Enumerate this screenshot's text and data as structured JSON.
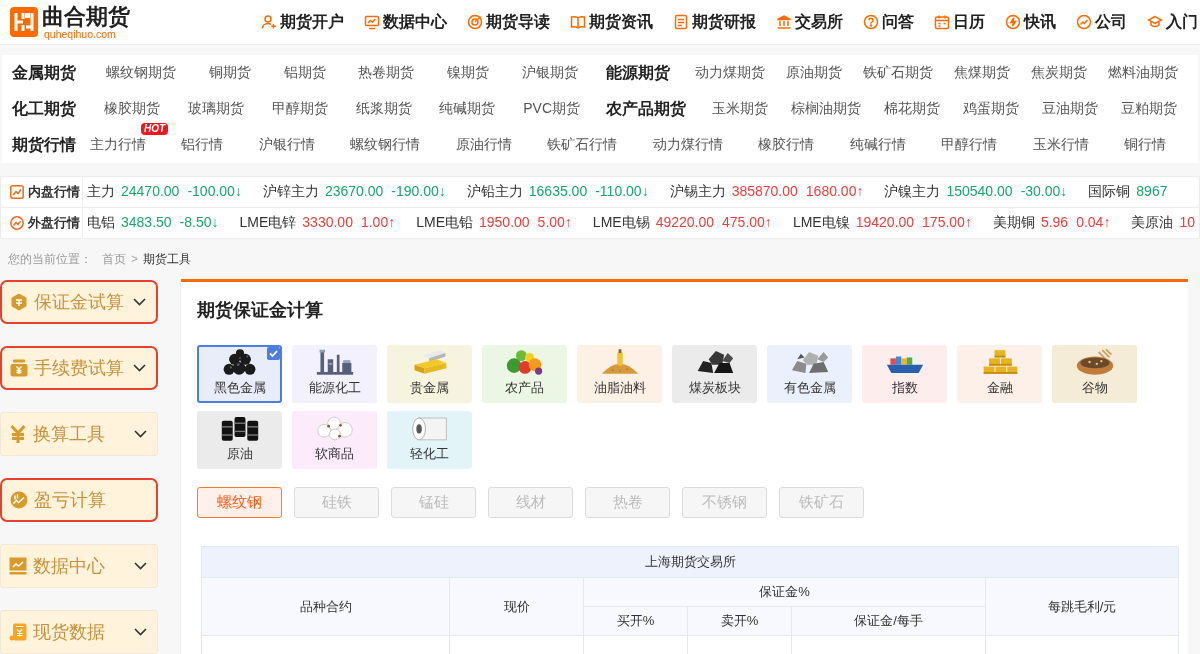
{
  "header": {
    "logo": {
      "name": "曲合期货",
      "domain": "quheqihuo.com"
    },
    "nav": [
      "期货开户",
      "数据中心",
      "期货导读",
      "期货资讯",
      "期货研报",
      "交易所",
      "问答",
      "日历",
      "快讯",
      "公司",
      "入门"
    ]
  },
  "category_nav": {
    "rows": [
      {
        "groups": [
          {
            "title": "金属期货",
            "items": [
              {
                "label": "螺纹钢期货"
              },
              {
                "label": "铜期货"
              },
              {
                "label": "铝期货"
              },
              {
                "label": "热卷期货"
              },
              {
                "label": "镍期货"
              },
              {
                "label": "沪银期货"
              }
            ]
          },
          {
            "title": "能源期货",
            "items": [
              {
                "label": "动力煤期货"
              },
              {
                "label": "原油期货"
              },
              {
                "label": "铁矿石期货"
              },
              {
                "label": "焦煤期货"
              },
              {
                "label": "焦炭期货"
              },
              {
                "label": "燃料油期货"
              }
            ]
          }
        ]
      },
      {
        "groups": [
          {
            "title": "化工期货",
            "items": [
              {
                "label": "橡胶期货"
              },
              {
                "label": "玻璃期货"
              },
              {
                "label": "甲醇期货"
              },
              {
                "label": "纸浆期货"
              },
              {
                "label": "纯碱期货"
              },
              {
                "label": "PVC期货"
              }
            ]
          },
          {
            "title": "农产品期货",
            "items": [
              {
                "label": "玉米期货"
              },
              {
                "label": "棕榈油期货"
              },
              {
                "label": "棉花期货"
              },
              {
                "label": "鸡蛋期货"
              },
              {
                "label": "豆油期货"
              },
              {
                "label": "豆粕期货"
              }
            ]
          }
        ]
      },
      {
        "groups": [
          {
            "title": "期货行情",
            "items": [
              {
                "label": "主力行情",
                "badge": "HOT"
              },
              {
                "label": "铝行情"
              },
              {
                "label": "沪银行情"
              },
              {
                "label": "螺纹钢行情"
              },
              {
                "label": "原油行情"
              },
              {
                "label": "铁矿石行情"
              },
              {
                "label": "动力煤行情"
              },
              {
                "label": "橡胶行情"
              },
              {
                "label": "纯碱行情"
              },
              {
                "label": "甲醇行情"
              },
              {
                "label": "玉米行情"
              },
              {
                "label": "铜行情"
              }
            ]
          }
        ]
      }
    ]
  },
  "tickers": [
    {
      "label": "内盘行情",
      "quotes": [
        {
          "name": "主力",
          "price": "24470.00",
          "change": "-100.00↓",
          "rising": false
        },
        {
          "name": "沪锌主力",
          "price": "23670.00",
          "change": "-190.00↓",
          "rising": false
        },
        {
          "name": "沪铅主力",
          "price": "16635.00",
          "change": "-110.00↓",
          "rising": false
        },
        {
          "name": "沪锡主力",
          "price": "385870.00",
          "change": "1680.00↑",
          "rising": true
        },
        {
          "name": "沪镍主力",
          "price": "150540.00",
          "change": "-30.00↓",
          "rising": false
        },
        {
          "name": "国际铜",
          "price": "8967",
          "rising": false
        }
      ]
    },
    {
      "label": "外盘行情",
      "quotes": [
        {
          "name": "电铝",
          "price": "3483.50",
          "change": "-8.50↓",
          "rising": false
        },
        {
          "name": "LME电锌",
          "price": "3330.00",
          "change": "1.00↑",
          "rising": true
        },
        {
          "name": "LME电铅",
          "price": "1950.00",
          "change": "5.00↑",
          "rising": true
        },
        {
          "name": "LME电锡",
          "price": "49220.00",
          "change": "475.00↑",
          "rising": true
        },
        {
          "name": "LME电镍",
          "price": "19420.00",
          "change": "175.00↑",
          "rising": true
        },
        {
          "name": "美期铜",
          "price": "5.96",
          "change": "0.04↑",
          "rising": true
        },
        {
          "name": "美原油",
          "price": "10",
          "rising": true
        }
      ]
    }
  ],
  "breadcrumb": {
    "label": "您的当前位置：",
    "links": [
      "首页"
    ],
    "separator": ">",
    "current": "期货工具"
  },
  "sidebar": {
    "items": [
      {
        "label": "保证金试算",
        "outlined": true,
        "expandable": true
      },
      {
        "label": "手续费试算",
        "outlined": true,
        "expandable": true
      },
      {
        "label": "换算工具",
        "outlined": false,
        "expandable": true
      },
      {
        "label": "盈亏计算",
        "outlined": true,
        "expandable": false
      },
      {
        "label": "数据中心",
        "outlined": false,
        "expandable": true
      },
      {
        "label": "现货数据",
        "outlined": false,
        "expandable": true
      }
    ]
  },
  "main": {
    "title": "期货保证金计算",
    "categories": [
      {
        "label": "黑色金属",
        "selected": true,
        "color": "#e8edf9"
      },
      {
        "label": "能源化工",
        "selected": false,
        "color": "#f3f1fd"
      },
      {
        "label": "贵金属",
        "selected": false,
        "color": "#f6f4de"
      },
      {
        "label": "农产品",
        "selected": false,
        "color": "#ebf7e4"
      },
      {
        "label": "油脂油料",
        "selected": false,
        "color": "#fcf1e4"
      },
      {
        "label": "煤炭板块",
        "selected": false,
        "color": "#ebebeb"
      },
      {
        "label": "有色金属",
        "selected": false,
        "color": "#ebf1fc"
      },
      {
        "label": "指数",
        "selected": false,
        "color": "#fdeded"
      },
      {
        "label": "金融",
        "selected": false,
        "color": "#fcf0e8"
      },
      {
        "label": "谷物",
        "selected": false,
        "color": "#f5ecd7"
      },
      {
        "label": "原油",
        "selected": false,
        "color": "#ebebeb"
      },
      {
        "label": "软商品",
        "selected": false,
        "color": "#fbebfb"
      },
      {
        "label": "轻化工",
        "selected": false,
        "color": "#e2f4f8"
      }
    ],
    "varieties": [
      {
        "label": "螺纹钢",
        "selected": true
      },
      {
        "label": "硅铁",
        "selected": false
      },
      {
        "label": "锰硅",
        "selected": false
      },
      {
        "label": "线材",
        "selected": false
      },
      {
        "label": "热卷",
        "selected": false
      },
      {
        "label": "不锈钢",
        "selected": false
      },
      {
        "label": "铁矿石",
        "selected": false
      }
    ],
    "table": {
      "title": "上海期货交易所",
      "columns": [
        {
          "label": "品种合约"
        },
        {
          "label": "现价"
        },
        {
          "label": "保证金%",
          "children": [
            {
              "label": "买开%"
            },
            {
              "label": "卖开%"
            },
            {
              "label": "保证金/每手"
            }
          ]
        },
        {
          "label": "每跳毛利/元"
        }
      ]
    }
  }
}
